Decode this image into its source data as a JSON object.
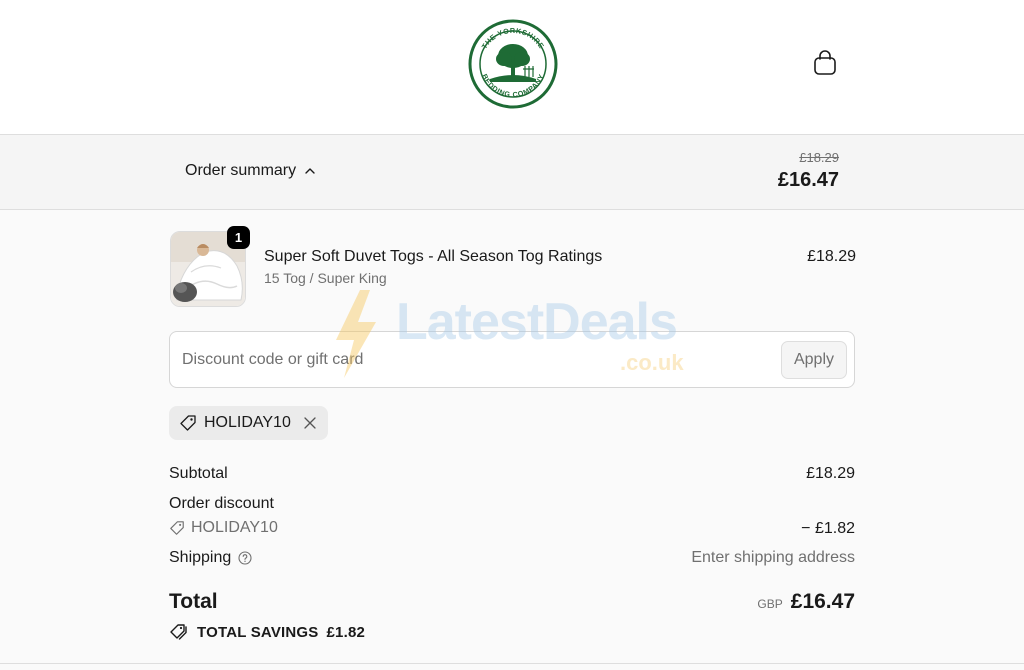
{
  "header": {
    "logo": {
      "top_text": "THE YORKSHIRE",
      "bottom_text": "BEDDING COMPANY",
      "brand_color": "#1e6b35",
      "icon": "tree-logo-icon"
    },
    "cart_icon": "shopping-bag-icon"
  },
  "summary_bar": {
    "toggle_label": "Order summary",
    "toggle_icon": "chevron-up-icon",
    "original_price": "£18.29",
    "total_price": "£16.47"
  },
  "product": {
    "quantity": "1",
    "name": "Super Soft Duvet Togs - All Season Tog Ratings",
    "variant": "15 Tog / Super King",
    "price": "£18.29",
    "thumbnail_icon": "duvet-product-image"
  },
  "discount": {
    "placeholder": "Discount code or gift card",
    "value": "",
    "apply_label": "Apply",
    "applied_code": "HOLIDAY10",
    "tag_icon": "tag-icon",
    "remove_icon": "close-icon"
  },
  "watermark": {
    "text": "LatestDeals",
    "sub": ".co.uk"
  },
  "totals": {
    "subtotal_label": "Subtotal",
    "subtotal_value": "£18.29",
    "order_discount_label": "Order discount",
    "discount_code": "HOLIDAY10",
    "discount_value": "− £1.82",
    "shipping_label": "Shipping",
    "shipping_value": "Enter shipping address",
    "total_label": "Total",
    "currency": "GBP",
    "total_value": "£16.47",
    "savings_label": "TOTAL SAVINGS",
    "savings_value": "£1.82"
  },
  "colors": {
    "accent": "#1e6b35",
    "text": "#1a1a1a",
    "muted": "#707070",
    "summary_bg": "#f5f5f5"
  }
}
